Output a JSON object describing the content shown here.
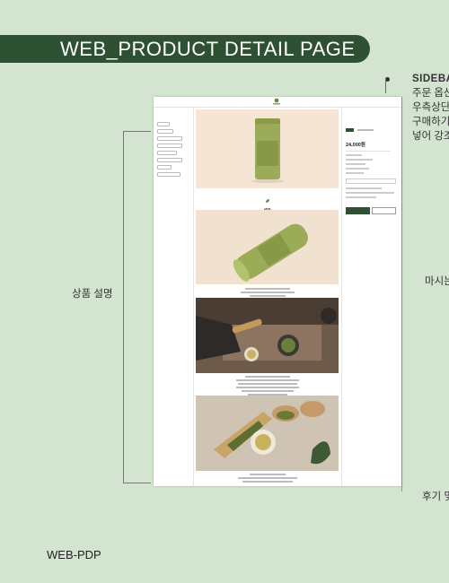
{
  "banner": {
    "title": "WEB_PRODUCT DETAIL PAGE"
  },
  "sidebar_note": {
    "title": "SIDEBA",
    "lines": [
      "주문 옵션",
      "우측상단",
      "구매하기",
      "넣어 강조"
    ]
  },
  "labels": {
    "product_desc": "상품 설명",
    "right_mid": "마시는",
    "right_bottom": "후기 및"
  },
  "footer": {
    "label": "WEB-PDP"
  },
  "mockup": {
    "product_name": "세작",
    "product_subtitle": "Sejak green tea",
    "price": "24,000원"
  },
  "colors": {
    "background": "#d3e4d0",
    "brand_green": "#2f5133",
    "canister": "#8fa04e"
  }
}
